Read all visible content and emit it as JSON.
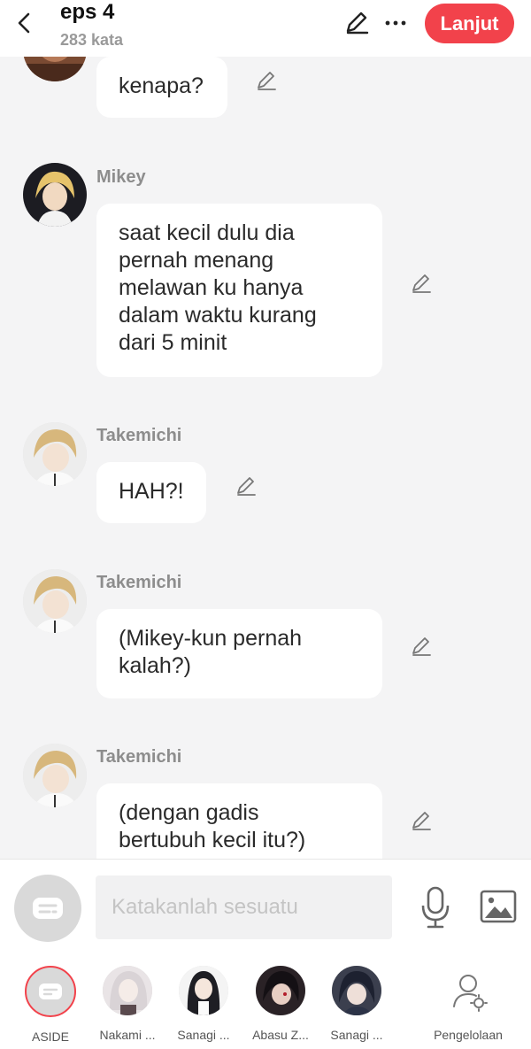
{
  "header": {
    "title": "eps 4",
    "word_count": "283 kata",
    "next_label": "Lanjut"
  },
  "messages": [
    {
      "speaker": "",
      "text": "kenapa?"
    },
    {
      "speaker": "Mikey",
      "text": "saat kecil dulu dia\npernah menang\nmelawan ku hanya\ndalam waktu kurang\ndari 5 minit"
    },
    {
      "speaker": "Takemichi",
      "text": "HAH?!"
    },
    {
      "speaker": "Takemichi",
      "text": "(Mikey-kun pernah\nkalah?)"
    },
    {
      "speaker": "Takemichi",
      "text": "(dengan gadis\nbertubuh kecil itu?)"
    }
  ],
  "input": {
    "placeholder": "Katakanlah sesuatu"
  },
  "cast": [
    {
      "label": "ASIDE"
    },
    {
      "label": "Nakami ..."
    },
    {
      "label": "Sanagi ..."
    },
    {
      "label": "Abasu Z..."
    },
    {
      "label": "Sanagi ..."
    },
    {
      "label": "Pengelolaan"
    }
  ],
  "colors": {
    "accent": "#f2424b",
    "background": "#f4f4f5",
    "bubble": "#ffffff",
    "speaker_name": "#8d8d8d"
  },
  "icons": [
    "back-arrow-icon",
    "pencil-icon",
    "more-dots-icon",
    "microphone-icon",
    "image-icon",
    "chat-bubble-icon",
    "user-gear-icon"
  ]
}
